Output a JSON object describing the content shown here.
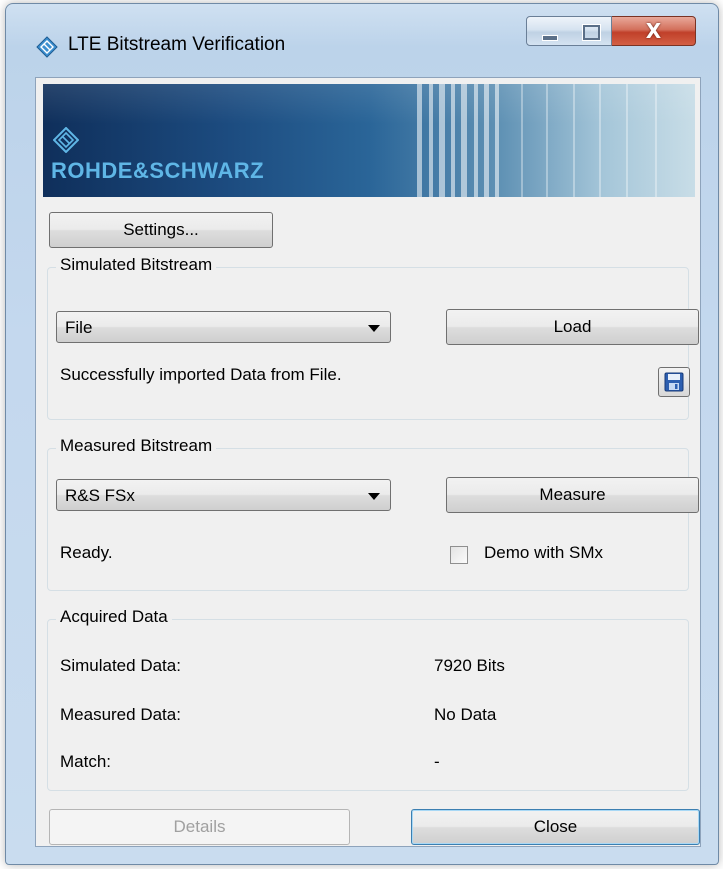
{
  "window": {
    "title": "LTE Bitstream Verification",
    "close_glyph": "X"
  },
  "banner": {
    "brand": "ROHDE&SCHWARZ"
  },
  "toolbar": {
    "settings_label": "Settings..."
  },
  "simulated": {
    "group_title": "Simulated Bitstream",
    "source_selected": "File",
    "load_label": "Load",
    "status": "Successfully imported Data from File."
  },
  "measured": {
    "group_title": "Measured Bitstream",
    "instrument_selected": "R&S FSx",
    "measure_label": "Measure",
    "status": "Ready.",
    "demo_label": "Demo with SMx",
    "demo_checked": false
  },
  "acquired": {
    "group_title": "Acquired Data",
    "rows": [
      {
        "label": "Simulated Data:",
        "value": "7920 Bits"
      },
      {
        "label": "Measured Data:",
        "value": "No Data"
      },
      {
        "label": "Match:",
        "value": "-"
      }
    ]
  },
  "footer": {
    "details_label": "Details",
    "close_label": "Close"
  },
  "colors": {
    "brand_text": "#5fb6e6",
    "banner_dark": "#0f2f5b",
    "close_button": "#c0402a"
  },
  "icons": [
    "rohde-schwarz-diamond-icon",
    "floppy-disk-icon",
    "minimize-icon",
    "maximize-icon",
    "close-icon",
    "dropdown-arrow-icon"
  ]
}
